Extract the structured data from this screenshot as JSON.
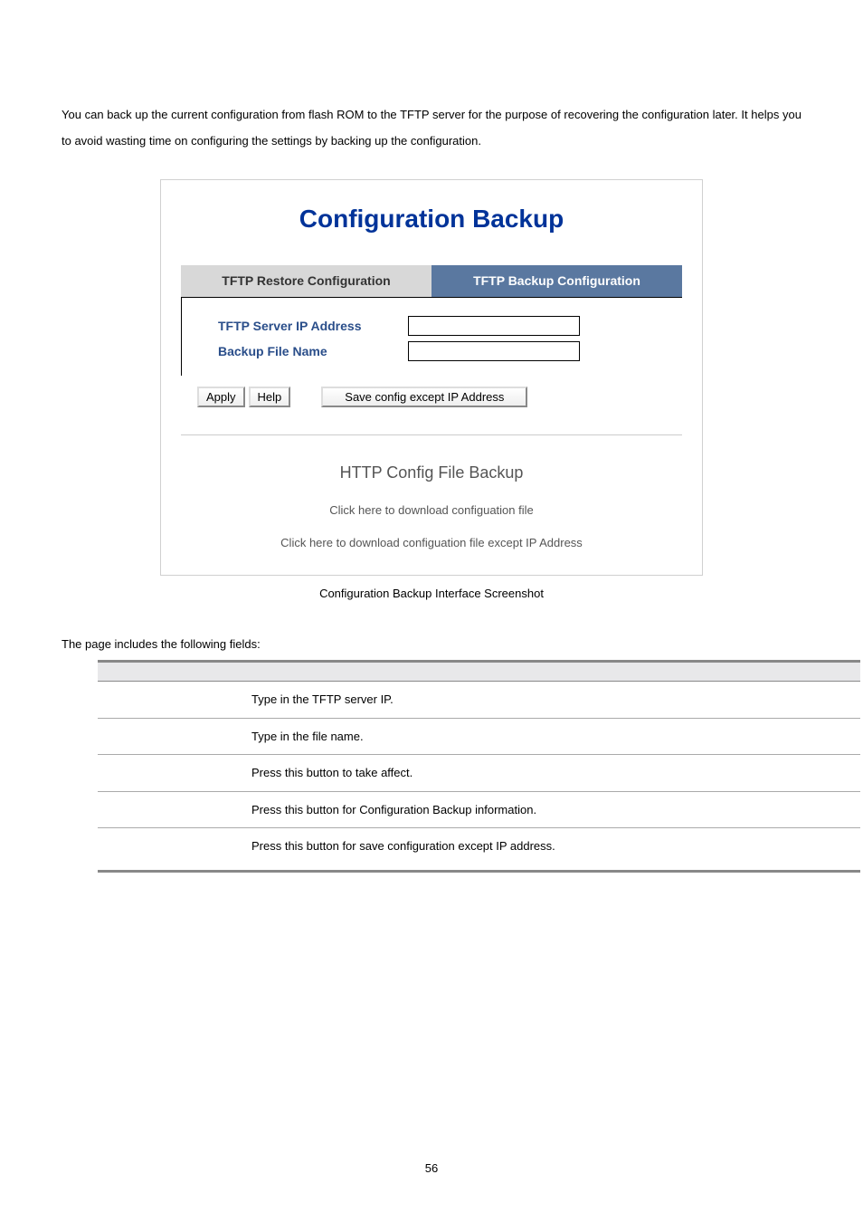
{
  "intro": "You can back up the current configuration from flash ROM to the TFTP server for the purpose of recovering the configuration later. It helps you to avoid wasting time on configuring the settings by backing up the configuration.",
  "screenshot": {
    "title": "Configuration Backup",
    "tabs": {
      "inactive": "TFTP Restore Configuration",
      "active": "TFTP Backup Configuration"
    },
    "form": {
      "ip_label": "TFTP Server IP Address",
      "ip_value": "",
      "file_label": "Backup File Name",
      "file_value": ""
    },
    "buttons": {
      "apply": "Apply",
      "help": "Help",
      "save_except": "Save config except IP Address"
    },
    "http": {
      "heading": "HTTP Config File Backup",
      "link1": "Click here to download configuation file",
      "link2": "Click here to download configuation file except IP Address"
    }
  },
  "caption": "Configuration Backup Interface Screenshot",
  "fields_intro": "The page includes the following fields:",
  "fields": [
    "Type in the TFTP server IP.",
    "Type in the file name.",
    "Press this button to take affect.",
    "Press this button for Configuration Backup information.",
    "Press this button for save configuration except IP address."
  ],
  "page_num": "56"
}
